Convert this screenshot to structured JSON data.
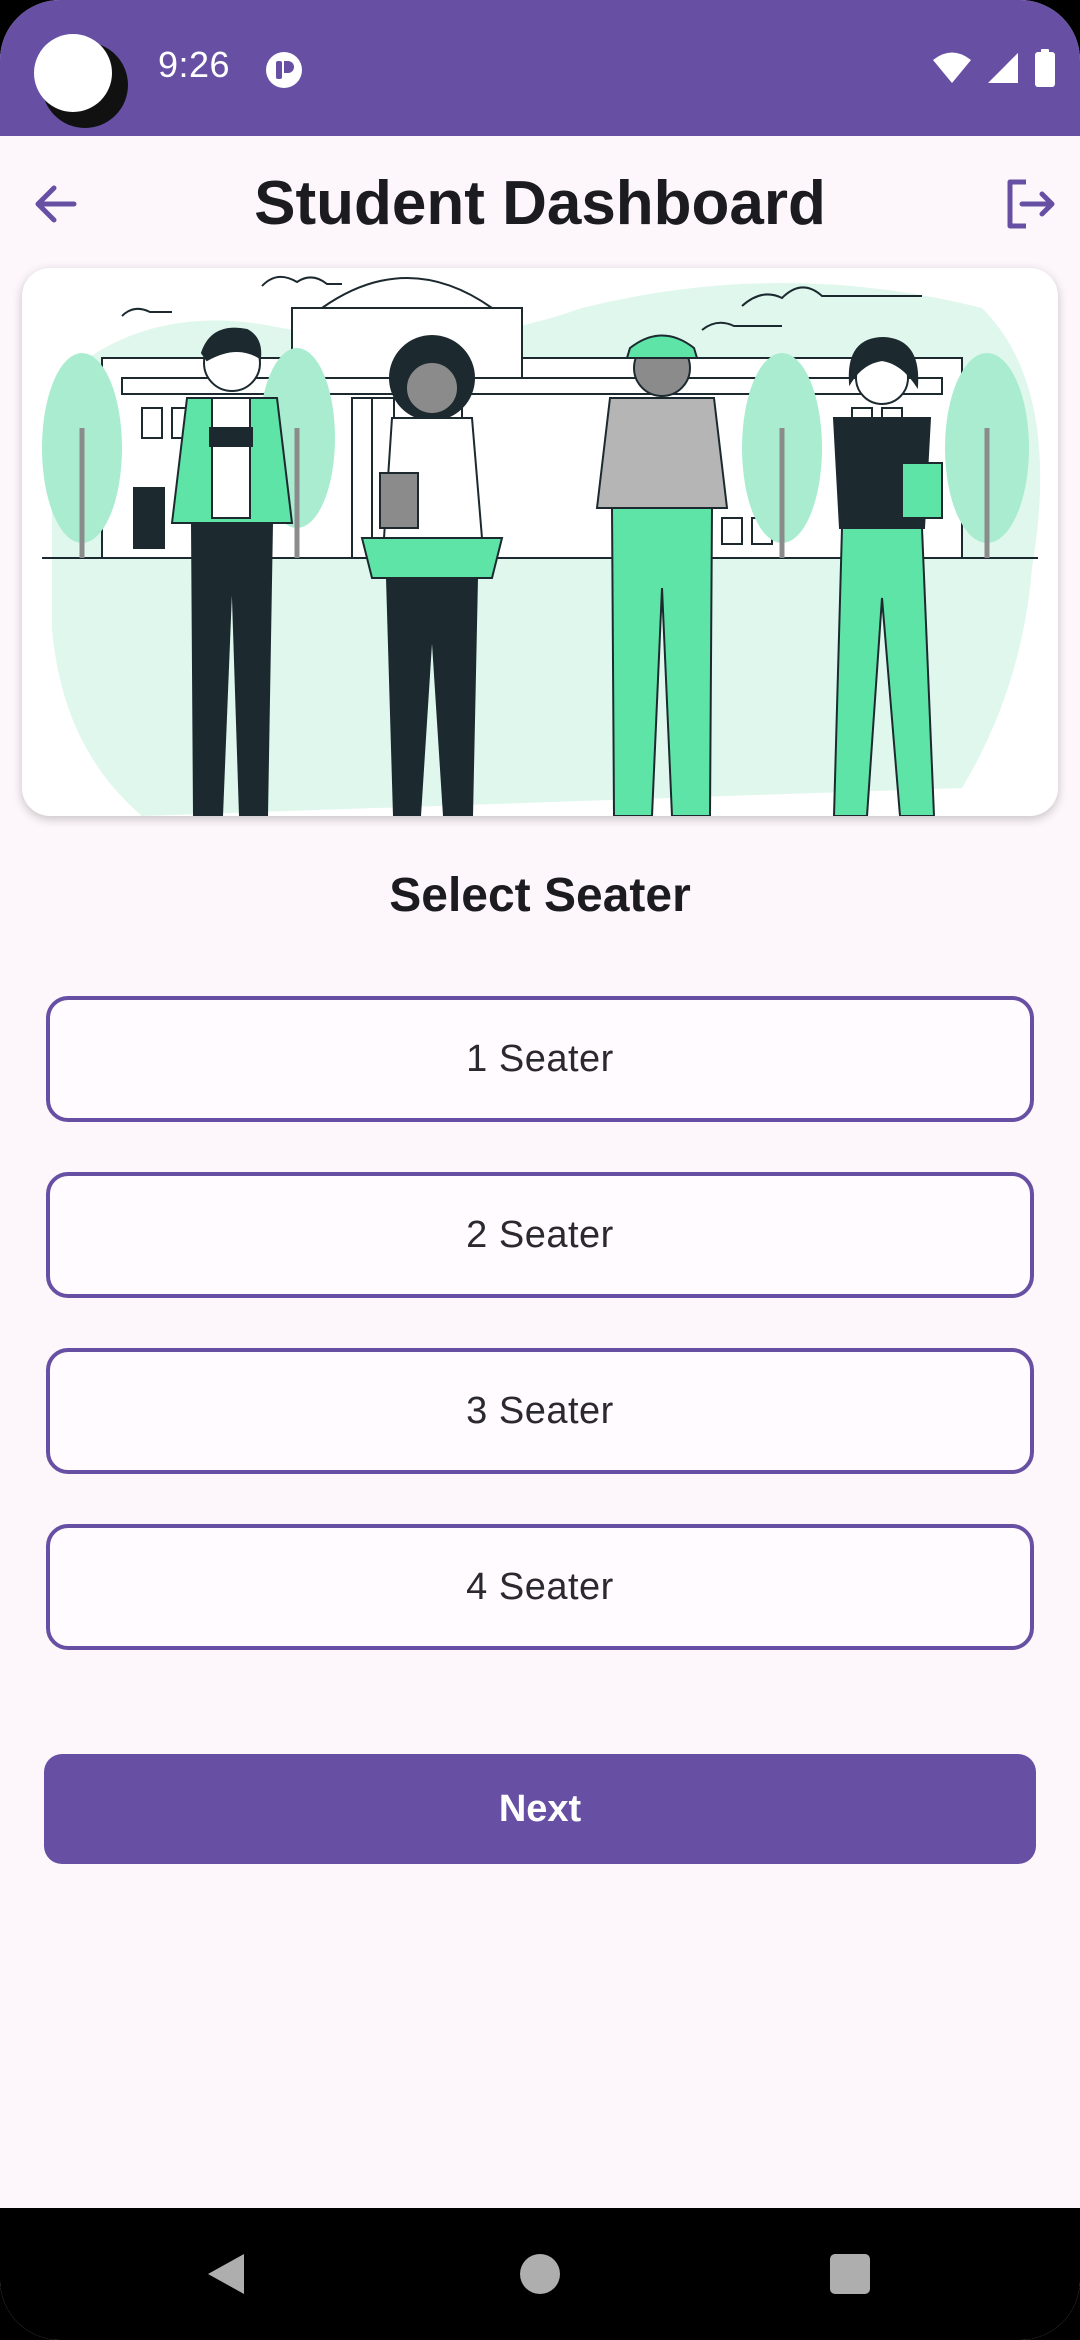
{
  "status_bar": {
    "time": "9:26",
    "icons": [
      "notification-app-icon",
      "wifi-icon",
      "signal-icon",
      "battery-icon"
    ]
  },
  "app_bar": {
    "title": "Student Dashboard",
    "back_icon": "arrow-left-icon",
    "logout_icon": "logout-icon"
  },
  "hero": {
    "illustration": "students-campus-illustration"
  },
  "section": {
    "title": "Select Seater"
  },
  "options": [
    {
      "label": "1 Seater"
    },
    {
      "label": "2 Seater"
    },
    {
      "label": "3 Seater"
    },
    {
      "label": "4 Seater"
    }
  ],
  "actions": {
    "next_label": "Next"
  },
  "colors": {
    "primary": "#6750a4",
    "background": "#fdf7fb",
    "accent_green": "#5ee4a6",
    "light_green": "#d9f6e8",
    "dark": "#1c2a30"
  },
  "nav_bar": {
    "icons": [
      "nav-back-icon",
      "nav-home-icon",
      "nav-recents-icon"
    ]
  }
}
